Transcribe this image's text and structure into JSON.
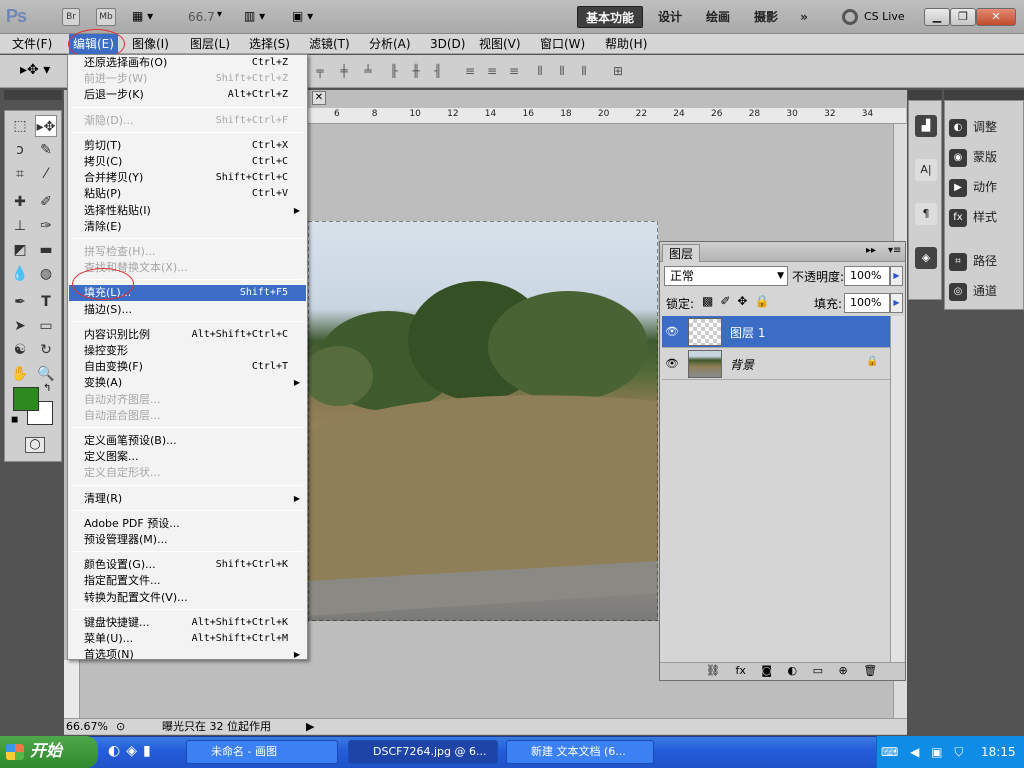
{
  "app": {
    "logo": "Ps",
    "bridge": "Br",
    "minibridge": "Mb",
    "zoom": "66.7",
    "workspaces": [
      "基本功能",
      "设计",
      "绘画",
      "摄影"
    ],
    "more": "»",
    "cslive": "CS Live"
  },
  "menubar": [
    "文件(F)",
    "编辑(E)",
    "图像(I)",
    "图层(L)",
    "选择(S)",
    "滤镜(T)",
    "分析(A)",
    "3D(D)",
    "视图(V)",
    "窗口(W)",
    "帮助(H)"
  ],
  "ruler": [
    "6",
    "8",
    "10",
    "12",
    "14",
    "16",
    "18",
    "20",
    "22",
    "24",
    "26",
    "28",
    "30",
    "32",
    "34"
  ],
  "edit_menu": [
    {
      "label": "还原选择画布(O)",
      "shortcut": "Ctrl+Z"
    },
    {
      "label": "前进一步(W)",
      "shortcut": "Shift+Ctrl+Z",
      "disabled": true
    },
    {
      "label": "后退一步(K)",
      "shortcut": "Alt+Ctrl+Z"
    },
    {
      "label": "渐隐(D)...",
      "shortcut": "Shift+Ctrl+F",
      "disabled": true
    },
    {
      "label": "剪切(T)",
      "shortcut": "Ctrl+X"
    },
    {
      "label": "拷贝(C)",
      "shortcut": "Ctrl+C"
    },
    {
      "label": "合并拷贝(Y)",
      "shortcut": "Shift+Ctrl+C"
    },
    {
      "label": "粘贴(P)",
      "shortcut": "Ctrl+V"
    },
    {
      "label": "选择性粘贴(I)",
      "submenu": true
    },
    {
      "label": "清除(E)"
    },
    {
      "label": "拼写检查(H)...",
      "disabled": true
    },
    {
      "label": "查找和替换文本(X)...",
      "disabled": true
    },
    {
      "label": "填充(L)...",
      "shortcut": "Shift+F5",
      "highlighted": true
    },
    {
      "label": "描边(S)..."
    },
    {
      "label": "内容识别比例",
      "shortcut": "Alt+Shift+Ctrl+C"
    },
    {
      "label": "操控变形"
    },
    {
      "label": "自由变换(F)",
      "shortcut": "Ctrl+T"
    },
    {
      "label": "变换(A)",
      "submenu": true
    },
    {
      "label": "自动对齐图层...",
      "disabled": true
    },
    {
      "label": "自动混合图层...",
      "disabled": true
    },
    {
      "label": "定义画笔预设(B)..."
    },
    {
      "label": "定义图案..."
    },
    {
      "label": "定义自定形状...",
      "disabled": true
    },
    {
      "label": "清理(R)",
      "submenu": true
    },
    {
      "label": "Adobe PDF 预设..."
    },
    {
      "label": "预设管理器(M)..."
    },
    {
      "label": "颜色设置(G)...",
      "shortcut": "Shift+Ctrl+K"
    },
    {
      "label": "指定配置文件..."
    },
    {
      "label": "转换为配置文件(V)..."
    },
    {
      "label": "键盘快捷键...",
      "shortcut": "Alt+Shift+Ctrl+K"
    },
    {
      "label": "菜单(U)...",
      "shortcut": "Alt+Shift+Ctrl+M"
    },
    {
      "label": "首选项(N)",
      "submenu": true
    }
  ],
  "dock": {
    "panels": [
      "调整",
      "蒙版",
      "动作",
      "样式",
      "路径",
      "通道"
    ]
  },
  "layers_panel": {
    "tab": "图层",
    "blend_mode": "正常",
    "opacity_label": "不透明度:",
    "opacity": "100%",
    "lock_label": "锁定:",
    "fill_label": "填充:",
    "fill": "100%",
    "layers": [
      "图层 1",
      "背景"
    ]
  },
  "status": {
    "zoom": "66.67%",
    "message": "曝光只在 32 位起作用"
  },
  "taskbar": {
    "start": "开始",
    "tasks": [
      "未命名 - 画图",
      "DSCF7264.jpg @ 6...",
      "新建 文本文档 (6..."
    ],
    "time": "18:15"
  },
  "colors": {
    "foreground": "#2d8a1f",
    "highlight": "#3b6dc6",
    "annotation": "#e23030"
  }
}
